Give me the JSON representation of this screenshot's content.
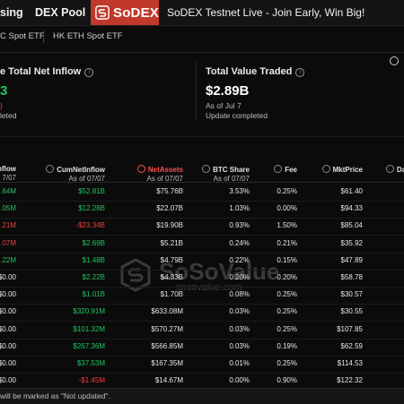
{
  "nav": {
    "item1": "sing",
    "item2": "DEX Pool",
    "brand": "SoDEX",
    "banner": "SoDEX Testnet Live - Join Early, Win Big!"
  },
  "tabs": [
    "C Spot ETF",
    "HK ETH Spot ETF"
  ],
  "cards": [
    {
      "title": "e Total Net Inflow",
      "value": "3",
      "line1": ")",
      "line2": "leted",
      "value_color": "#1ec85f"
    },
    {
      "title": "Total Value Traded",
      "value": "$2.89B",
      "line1": "As of Jul 7",
      "line2": "Update completed",
      "value_color": "#ffffff"
    }
  ],
  "table": {
    "columns": [
      {
        "label": "nflow",
        "sub": "7/07"
      },
      {
        "label": "CumNetInflow",
        "sub": "As of 07/07"
      },
      {
        "label": "NetAssets",
        "sub": "As of 07/07"
      },
      {
        "label": "BTC Share",
        "sub": "As of 07/07"
      },
      {
        "label": "Fee",
        "sub": ""
      },
      {
        "label": "MktPrice",
        "sub": ""
      },
      {
        "label": "Da",
        "sub": ""
      }
    ],
    "rows": [
      [
        "4.64M",
        "$52.81B",
        "$75.76B",
        "3.53%",
        "0.25%",
        "$61.40"
      ],
      [
        "6.05M",
        "$12.28B",
        "$22.07B",
        "1.03%",
        "0.00%",
        "$94.33"
      ],
      [
        "0.21M",
        "-$23.34B",
        "$19.90B",
        "0.93%",
        "1.50%",
        "$85.04"
      ],
      [
        "0.07M",
        "$2.69B",
        "$5.21B",
        "0.24%",
        "0.21%",
        "$35.92"
      ],
      [
        "6.22M",
        "$1.48B",
        "$4.79B",
        "0.22%",
        "0.15%",
        "$47.89"
      ],
      [
        "$0.00",
        "$2.22B",
        "$4.33B",
        "0.20%",
        "0.20%",
        "$58.78"
      ],
      [
        "$0.00",
        "$1.01B",
        "$1.70B",
        "0.08%",
        "0.25%",
        "$30.57"
      ],
      [
        "$0.00",
        "$320.91M",
        "$633.08M",
        "0.03%",
        "0.25%",
        "$30.55"
      ],
      [
        "$0.00",
        "$101.32M",
        "$570.27M",
        "0.03%",
        "0.25%",
        "$107.85"
      ],
      [
        "$0.00",
        "$267.36M",
        "$566.85M",
        "0.03%",
        "0.19%",
        "$62.59"
      ],
      [
        "$0.00",
        "$37.53M",
        "$167.35M",
        "0.01%",
        "0.25%",
        "$114.53"
      ],
      [
        "$0.00",
        "-$1.45M",
        "$14.67M",
        "0.00%",
        "0.90%",
        "$122.32"
      ]
    ],
    "inflow_colors": [
      "g",
      "g",
      "r",
      "r",
      "g",
      "w",
      "w",
      "w",
      "w",
      "w",
      "w",
      "w"
    ],
    "cum_colors": [
      "g",
      "g",
      "r",
      "g",
      "g",
      "g",
      "g",
      "g",
      "g",
      "g",
      "g",
      "r"
    ]
  },
  "watermark": {
    "title": "SoSoValue",
    "sub": "sosovalue.com"
  },
  "footer": "will be marked as \"Not updated\"."
}
